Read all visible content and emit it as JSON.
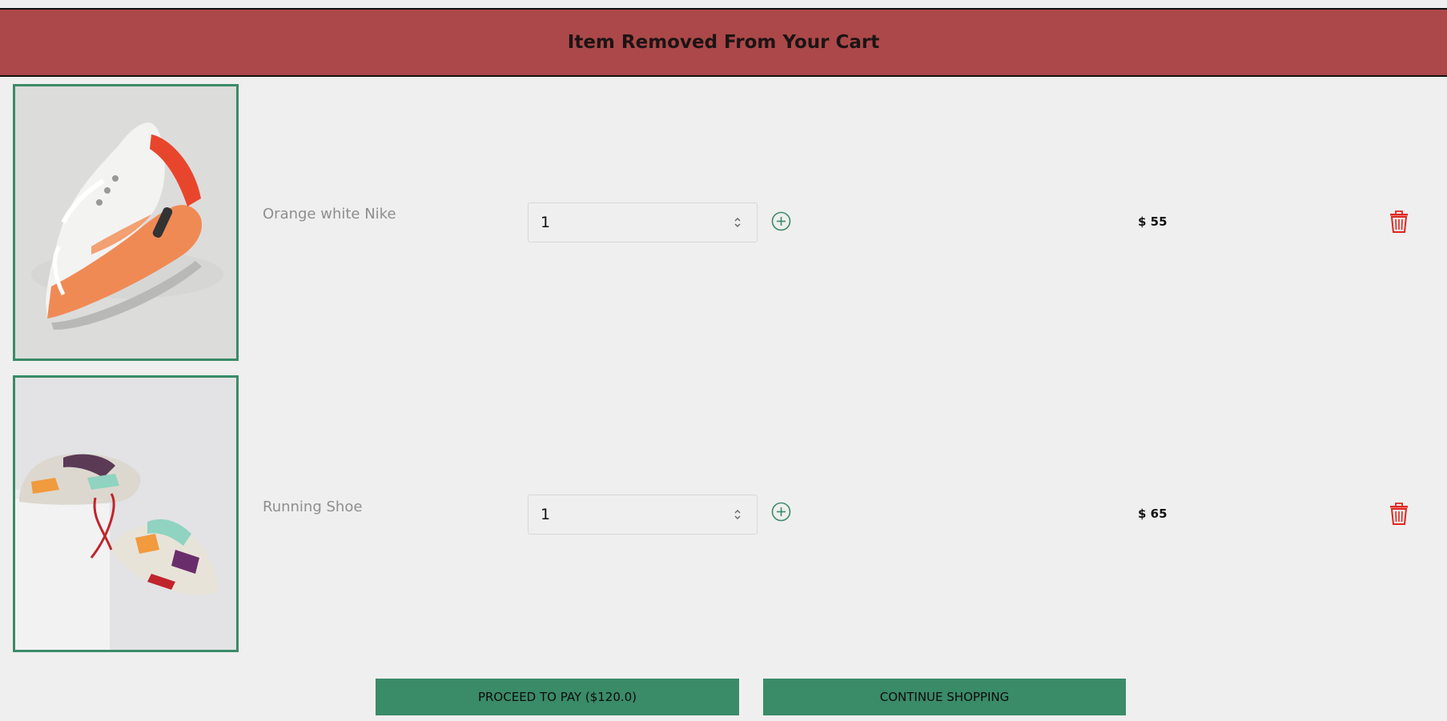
{
  "notification": {
    "message": "Item Removed From Your Cart",
    "background_color": "#ac4849"
  },
  "cart": {
    "items": [
      {
        "name": "Orange white Nike",
        "quantity": "1",
        "price": "$ 55",
        "image": "orange-white-nike-sneaker"
      },
      {
        "name": "Running Shoe",
        "quantity": "1",
        "price": "$ 65",
        "image": "running-shoe-pair"
      }
    ]
  },
  "actions": {
    "proceed_label": "PROCEED TO PAY ($120.0)",
    "continue_label": "CONTINUE SHOPPING"
  },
  "icons": {
    "add": "plus-circle-icon",
    "remove": "trash-icon",
    "spinner": "updown-arrows-icon"
  },
  "colors": {
    "accent": "#3a8b68",
    "danger": "#e0261e",
    "background": "#efefef"
  }
}
